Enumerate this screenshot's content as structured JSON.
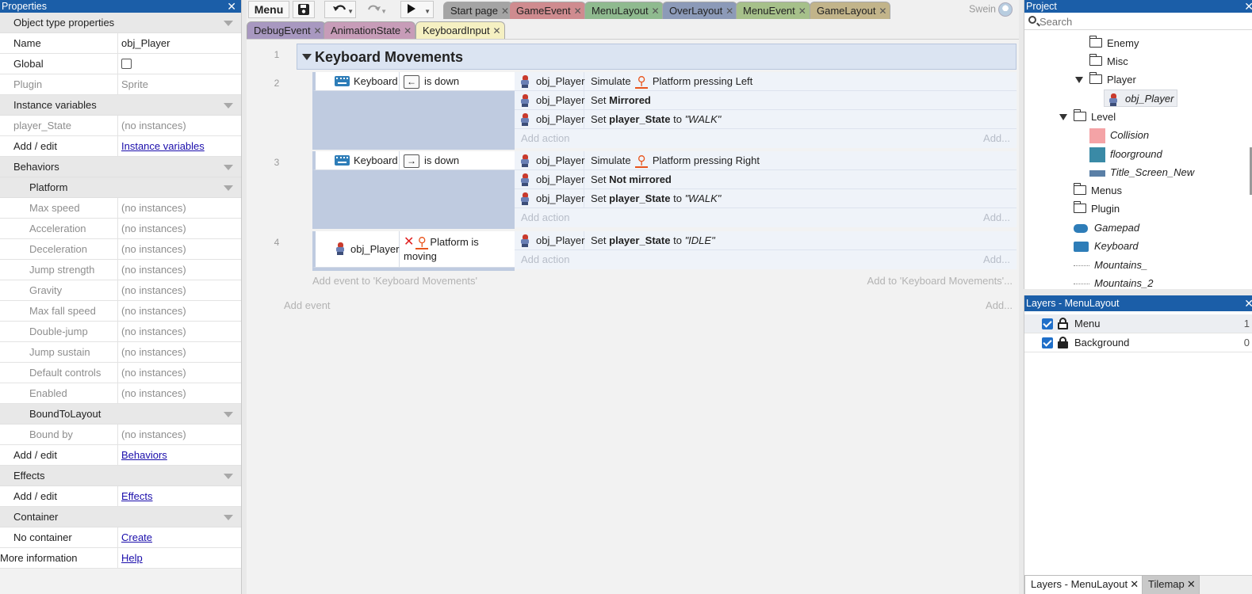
{
  "properties": {
    "title": "Properties",
    "rows": [
      {
        "type": "sec",
        "label": "Object type properties"
      },
      {
        "type": "kv",
        "key": "Name",
        "value": "obj_Player"
      },
      {
        "type": "check",
        "key": "Global"
      },
      {
        "type": "kv",
        "key": "Plugin",
        "value": "Sprite",
        "dim": true
      },
      {
        "type": "sec",
        "label": "Instance variables"
      },
      {
        "type": "kv",
        "key": "player_State",
        "value": "(no instances)",
        "dim": true
      },
      {
        "type": "link",
        "key": "Add / edit",
        "value": "Instance variables"
      },
      {
        "type": "sec",
        "label": "Behaviors"
      },
      {
        "type": "subsec",
        "label": "Platform"
      },
      {
        "type": "kv",
        "key": "Max speed",
        "value": "(no instances)",
        "dim": true,
        "ind": true
      },
      {
        "type": "kv",
        "key": "Acceleration",
        "value": "(no instances)",
        "dim": true,
        "ind": true
      },
      {
        "type": "kv",
        "key": "Deceleration",
        "value": "(no instances)",
        "dim": true,
        "ind": true
      },
      {
        "type": "kv",
        "key": "Jump strength",
        "value": "(no instances)",
        "dim": true,
        "ind": true
      },
      {
        "type": "kv",
        "key": "Gravity",
        "value": "(no instances)",
        "dim": true,
        "ind": true
      },
      {
        "type": "kv",
        "key": "Max fall speed",
        "value": "(no instances)",
        "dim": true,
        "ind": true
      },
      {
        "type": "kv",
        "key": "Double-jump",
        "value": "(no instances)",
        "dim": true,
        "ind": true
      },
      {
        "type": "kv",
        "key": "Jump sustain",
        "value": "(no instances)",
        "dim": true,
        "ind": true
      },
      {
        "type": "kv",
        "key": "Default controls",
        "value": "(no instances)",
        "dim": true,
        "ind": true
      },
      {
        "type": "kv",
        "key": "Enabled",
        "value": "(no instances)",
        "dim": true,
        "ind": true
      },
      {
        "type": "subsec",
        "label": "BoundToLayout"
      },
      {
        "type": "kv",
        "key": "Bound by",
        "value": "(no instances)",
        "dim": true,
        "ind": true
      },
      {
        "type": "link",
        "key": "Add / edit",
        "value": "Behaviors"
      },
      {
        "type": "sec",
        "label": "Effects"
      },
      {
        "type": "link",
        "key": "Add / edit",
        "value": "Effects"
      },
      {
        "type": "sec",
        "label": "Container"
      },
      {
        "type": "link",
        "key": "No container",
        "value": "Create"
      },
      {
        "type": "link",
        "key": "More information",
        "value": "Help",
        "full": true
      }
    ]
  },
  "toolbar": {
    "menu_label": "Menu",
    "save_icon": "save-icon",
    "undo_icon": "undo-icon",
    "redo_icon": "redo-icon",
    "play_icon": "play-icon",
    "user_name": "Swein"
  },
  "tabs_row1": [
    {
      "label": "Start page",
      "color": "#a4a4a4"
    },
    {
      "label": "GameEvent",
      "color": "#cf8b8f"
    },
    {
      "label": "MenuLayout",
      "color": "#8fba8f"
    },
    {
      "label": "OverLayout",
      "color": "#8c9ab8"
    },
    {
      "label": "MenuEvent",
      "color": "#a6c08a"
    },
    {
      "label": "GameLayout",
      "color": "#c2b48a"
    }
  ],
  "tabs_row2": [
    {
      "label": "DebugEvent",
      "color": "#a898c0"
    },
    {
      "label": "AnimationState",
      "color": "#c79cb8"
    },
    {
      "label": "KeyboardInput",
      "color": "#f5f0c2",
      "active": true
    }
  ],
  "event_sheet": {
    "group": {
      "line": "1",
      "title": "Keyboard Movements"
    },
    "events": [
      {
        "line": "2",
        "cond_obj": "Keyboard",
        "cond_icon": "keyboard-icon",
        "key": "←",
        "cond_text": "is down",
        "actions": [
          {
            "obj": "obj_Player",
            "pre": "Simulate",
            "bold": "",
            "post": "Platform pressing Left",
            "val": "",
            "run_icon": true
          },
          {
            "obj": "obj_Player",
            "pre": "Set",
            "bold": "Mirrored",
            "post": "",
            "val": ""
          },
          {
            "obj": "obj_Player",
            "pre": "Set",
            "bold": "player_State",
            "post": "to",
            "val": "\"WALK\""
          }
        ]
      },
      {
        "line": "3",
        "cond_obj": "Keyboard",
        "cond_icon": "keyboard-icon",
        "key": "→",
        "cond_text": "is down",
        "actions": [
          {
            "obj": "obj_Player",
            "pre": "Simulate",
            "bold": "",
            "post": "Platform pressing Right",
            "val": "",
            "run_icon": true
          },
          {
            "obj": "obj_Player",
            "pre": "Set",
            "bold": "Not mirrored",
            "post": "",
            "val": ""
          },
          {
            "obj": "obj_Player",
            "pre": "Set",
            "bold": "player_State",
            "post": "to",
            "val": "\"WALK\""
          }
        ]
      },
      {
        "line": "4",
        "cond_obj": "obj_Player",
        "cond_icon": "sprite-icon",
        "cond_text_1": "Platform is",
        "cond_text_2": "moving",
        "actions": [
          {
            "obj": "obj_Player",
            "pre": "Set",
            "bold": "player_State",
            "post": "to",
            "val": "\"IDLE\""
          }
        ]
      }
    ],
    "add_action": "Add action",
    "add_more": "Add...",
    "add_event_to_group": "Add event to 'Keyboard Movements'",
    "add_to_group": "Add to 'Keyboard Movements'...",
    "add_event": "Add event",
    "add_more_bottom": "Add..."
  },
  "project": {
    "title": "Project",
    "search_placeholder": "Search",
    "items": [
      {
        "label": "Enemy",
        "kind": "folder"
      },
      {
        "label": "Misc",
        "kind": "folder"
      },
      {
        "label": "Player",
        "kind": "folder",
        "expanded": true
      },
      {
        "label": "obj_Player",
        "kind": "sprite",
        "selected": true
      },
      {
        "label": "Level",
        "kind": "folder",
        "expanded": true
      },
      {
        "label": "Collision",
        "kind": "swatch",
        "color": "#f4a3a6"
      },
      {
        "label": "floorground",
        "kind": "swatch",
        "color": "#3a8aa6"
      },
      {
        "label": "Title_Screen_New",
        "kind": "swatch",
        "color": "#5a7fa6"
      },
      {
        "label": "Menus",
        "kind": "folder"
      },
      {
        "label": "Plugin",
        "kind": "folder"
      },
      {
        "label": "Gamepad",
        "kind": "gamepad"
      },
      {
        "label": "Keyboard",
        "kind": "keyboard"
      },
      {
        "label": "Mountains_",
        "kind": "line"
      },
      {
        "label": "Mountains_2",
        "kind": "line"
      }
    ]
  },
  "layers": {
    "title": "Layers - MenuLayout",
    "rows": [
      {
        "name": "Menu",
        "num": "1",
        "locked": false
      },
      {
        "name": "Background",
        "num": "0",
        "locked": true
      }
    ],
    "bottom_tabs": [
      {
        "label": "Layers - MenuLayout",
        "active": true
      },
      {
        "label": "Tilemap",
        "active": false
      }
    ]
  }
}
